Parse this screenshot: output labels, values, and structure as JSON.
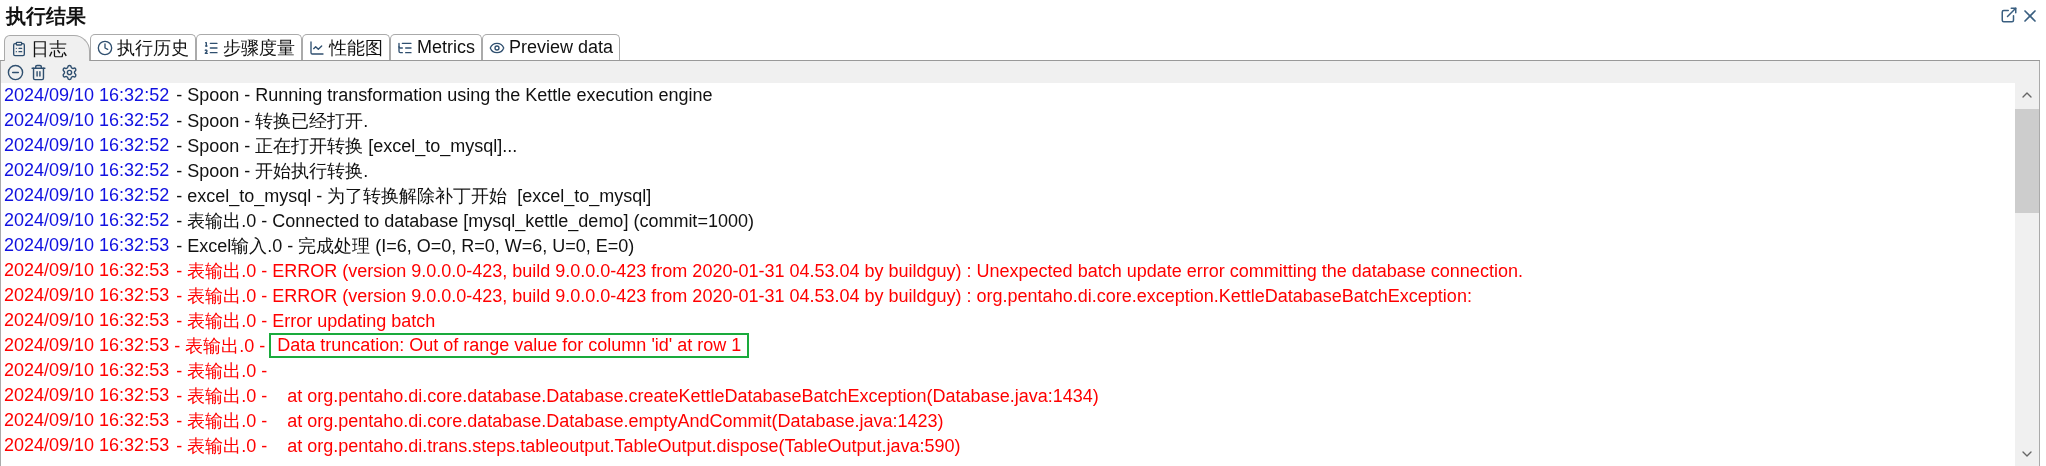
{
  "panel": {
    "title": "执行结果"
  },
  "tabs": [
    {
      "label": "日志",
      "selected": true
    },
    {
      "label": "执行历史",
      "selected": false
    },
    {
      "label": "步骤度量",
      "selected": false
    },
    {
      "label": "性能图",
      "selected": false
    },
    {
      "label": "Metrics",
      "selected": false
    },
    {
      "label": "Preview data",
      "selected": false
    }
  ],
  "log": [
    {
      "time": "2024/09/10 16:32:52",
      "text": " - Spoon - Running transformation using the Kettle execution engine",
      "kind": "info",
      "highlighted": false
    },
    {
      "time": "2024/09/10 16:32:52",
      "text": " - Spoon - 转换已经打开.",
      "kind": "info",
      "highlighted": false
    },
    {
      "time": "2024/09/10 16:32:52",
      "text": " - Spoon - 正在打开转换 [excel_to_mysql]...",
      "kind": "info",
      "highlighted": false
    },
    {
      "time": "2024/09/10 16:32:52",
      "text": " - Spoon - 开始执行转换.",
      "kind": "info",
      "highlighted": false
    },
    {
      "time": "2024/09/10 16:32:52",
      "text": " - excel_to_mysql - 为了转换解除补丁开始  [excel_to_mysql]",
      "kind": "info",
      "highlighted": false
    },
    {
      "time": "2024/09/10 16:32:52",
      "text": " - 表输出.0 - Connected to database [mysql_kettle_demo] (commit=1000)",
      "kind": "info",
      "highlighted": false
    },
    {
      "time": "2024/09/10 16:32:53",
      "text": " - Excel输入.0 - 完成处理 (I=6, O=0, R=0, W=6, U=0, E=0)",
      "kind": "info",
      "highlighted": false
    },
    {
      "time": "2024/09/10 16:32:53",
      "text": " - 表输出.0 - ERROR (version 9.0.0.0-423, build 9.0.0.0-423 from 2020-01-31 04.53.04 by buildguy) : Unexpected batch update error committing the database connection.",
      "kind": "error",
      "highlighted": false
    },
    {
      "time": "2024/09/10 16:32:53",
      "text": " - 表输出.0 - ERROR (version 9.0.0.0-423, build 9.0.0.0-423 from 2020-01-31 04.53.04 by buildguy) : org.pentaho.di.core.exception.KettleDatabaseBatchException:",
      "kind": "error",
      "highlighted": false
    },
    {
      "time": "2024/09/10 16:32:53",
      "text": " - 表输出.0 - Error updating batch",
      "kind": "error",
      "highlighted": false
    },
    {
      "time": "2024/09/10 16:32:53",
      "text": " - 表输出.0 -",
      "boxed_text": "Data truncation: Out of range value for column 'id' at row 1",
      "kind": "error",
      "highlighted": true
    },
    {
      "time": "2024/09/10 16:32:53",
      "text": " - 表输出.0 -",
      "kind": "error",
      "highlighted": false
    },
    {
      "time": "2024/09/10 16:32:53",
      "text": " - 表输出.0 -    at org.pentaho.di.core.database.Database.createKettleDatabaseBatchException(Database.java:1434)",
      "kind": "error",
      "highlighted": false
    },
    {
      "time": "2024/09/10 16:32:53",
      "text": " - 表输出.0 -    at org.pentaho.di.core.database.Database.emptyAndCommit(Database.java:1423)",
      "kind": "error",
      "highlighted": false
    },
    {
      "time": "2024/09/10 16:32:53",
      "text": " - 表输出.0 -    at org.pentaho.di.trans.steps.tableoutput.TableOutput.dispose(TableOutput.java:590)",
      "kind": "error",
      "highlighted": false
    }
  ]
}
